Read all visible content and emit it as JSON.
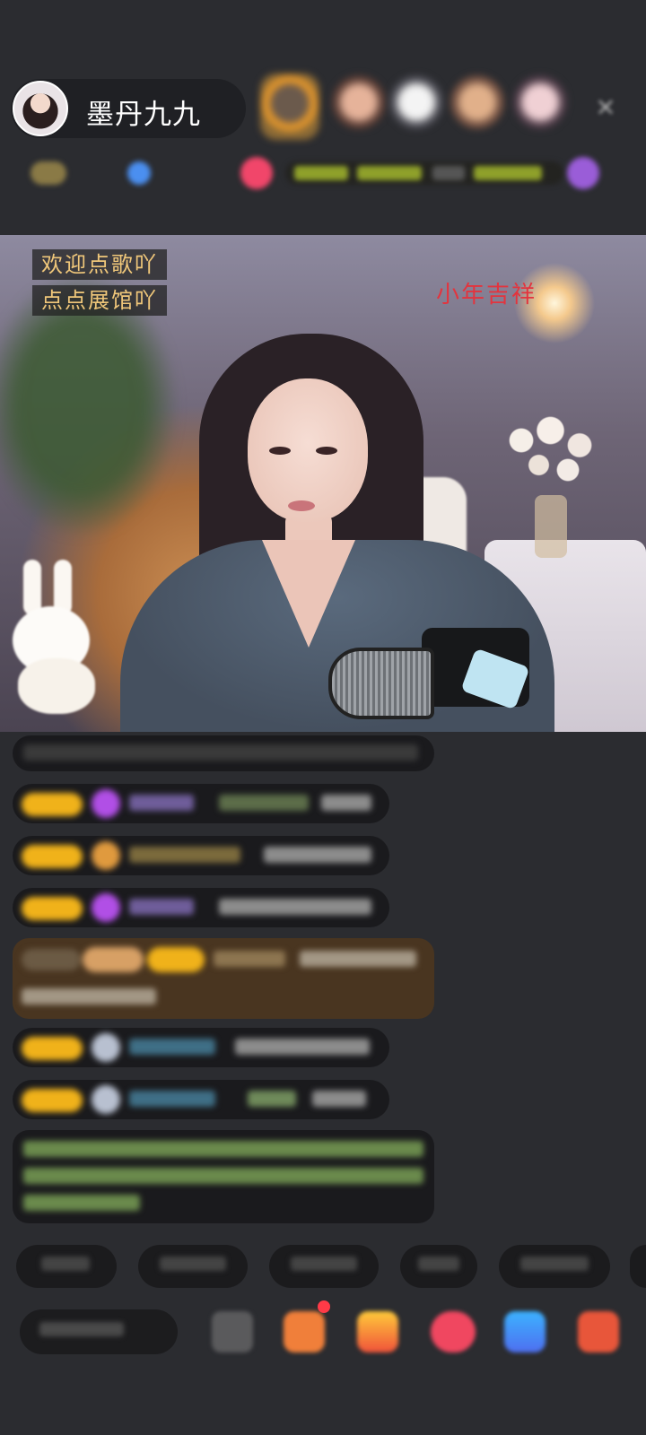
{
  "header": {
    "host_name": "墨丹九九",
    "close_icon": "×"
  },
  "video": {
    "sign_lines": [
      "欢迎点歌吖",
      "点点展馆吖"
    ],
    "watermark": "小年吉祥"
  },
  "colors": {
    "badge_gold": "#f0b21a",
    "background": "#2b2c30",
    "watermark_red": "#e3343e",
    "sign_text": "#f0c77a"
  },
  "icons": {
    "close": "close-icon",
    "emoji": "emoji-icon",
    "gift": "gift-icon",
    "purple_diamond": "diamond-icon"
  }
}
